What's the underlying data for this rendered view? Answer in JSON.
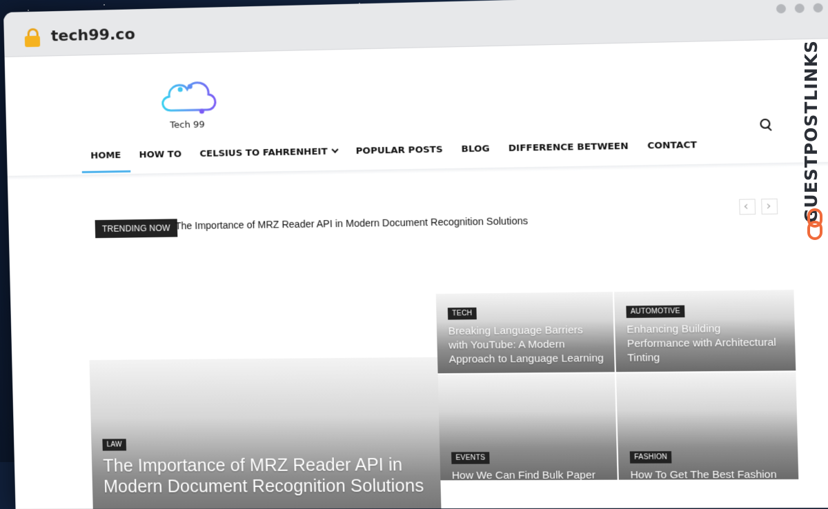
{
  "browser": {
    "url": "tech99.co"
  },
  "watermark": {
    "text": "GUESTPOSTLINKS"
  },
  "site": {
    "logo_text": "Tech 99",
    "accent": "#4db2ec"
  },
  "nav": {
    "items": [
      {
        "label": "HOME",
        "active": true
      },
      {
        "label": "HOW TO"
      },
      {
        "label": "CELSIUS TO FAHRENHEIT",
        "dropdown": true
      },
      {
        "label": "POPULAR POSTS"
      },
      {
        "label": "BLOG"
      },
      {
        "label": "DIFFERENCE BETWEEN"
      },
      {
        "label": "CONTACT"
      }
    ]
  },
  "trending": {
    "label": "TRENDING NOW",
    "headline": "The Importance of MRZ Reader API in Modern Document Recognition Solutions"
  },
  "featured": {
    "main": {
      "category": "LAW",
      "title": "The Importance of MRZ Reader API in Modern Document Recognition Solutions"
    },
    "tiles": [
      {
        "category": "TECH",
        "title": "Breaking Language Barriers with YouTube: A Modern Approach to Language Learning"
      },
      {
        "category": "AUTOMOTIVE",
        "title": "Enhancing Building Performance with Architectural Tinting"
      },
      {
        "category": "EVENTS",
        "title": "How We Can Find Bulk Paper"
      },
      {
        "category": "FASHION",
        "title": "How To Get The Best Fashion"
      }
    ]
  }
}
